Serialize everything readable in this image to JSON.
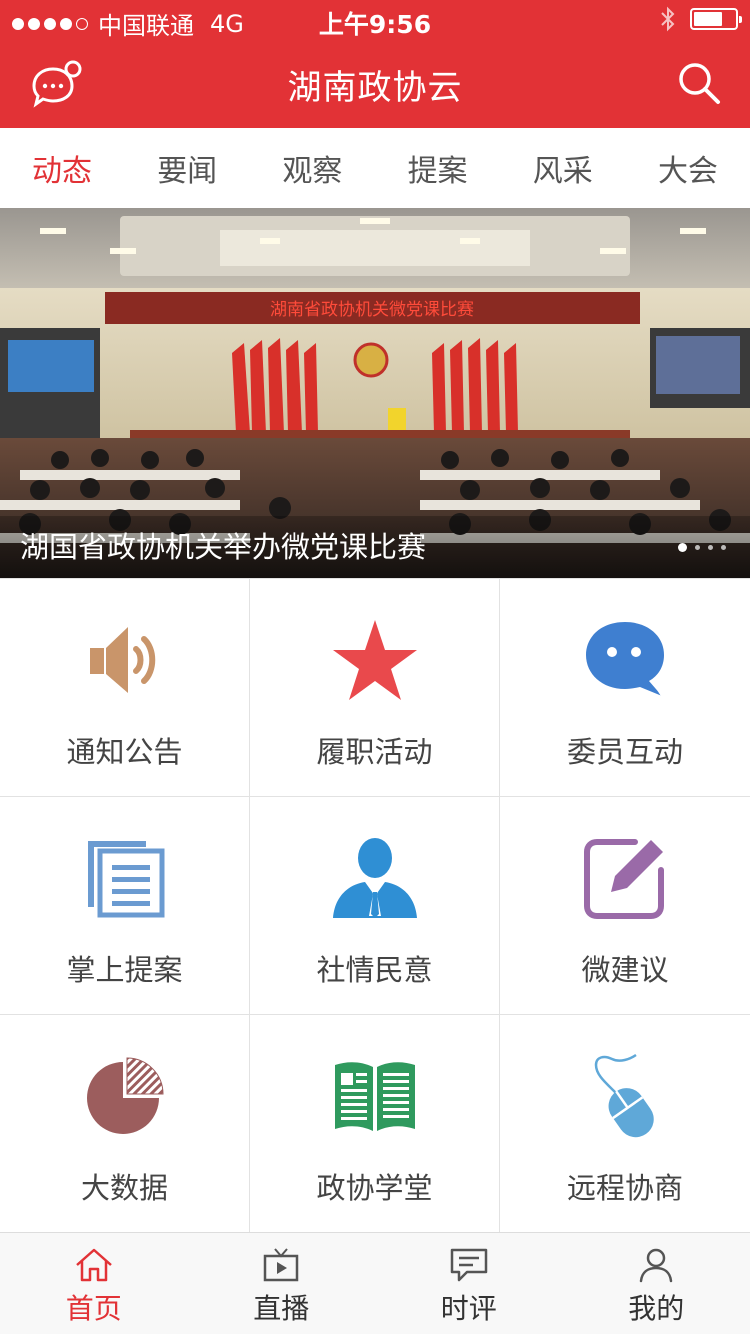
{
  "status_bar": {
    "carrier": "中国联通",
    "network": "4G",
    "time": "上午9:56"
  },
  "header": {
    "title": "湖南政协云",
    "left_icon": "message-bubble-icon",
    "right_icon": "search-icon"
  },
  "tabs": [
    {
      "label": "动态",
      "active": true
    },
    {
      "label": "要闻",
      "active": false
    },
    {
      "label": "观察",
      "active": false
    },
    {
      "label": "提案",
      "active": false
    },
    {
      "label": "风采",
      "active": false
    },
    {
      "label": "大会",
      "active": false
    }
  ],
  "banner": {
    "hall_sign": "湖南省政协机关微党课比赛",
    "caption": "湖国省政协机关举办微党课比赛",
    "page_count": 4,
    "current_page": 1
  },
  "grid": [
    {
      "label": "通知公告",
      "icon": "speaker-icon",
      "color": "#c9956a"
    },
    {
      "label": "履职活动",
      "icon": "star-icon",
      "color": "#e9494c"
    },
    {
      "label": "委员互动",
      "icon": "chat-bubble-icon",
      "color": "#3f7fd0"
    },
    {
      "label": "掌上提案",
      "icon": "documents-icon",
      "color": "#6b9bd1"
    },
    {
      "label": "社情民意",
      "icon": "person-icon",
      "color": "#2f8fd4"
    },
    {
      "label": "微建议",
      "icon": "edit-icon",
      "color": "#9a6aa8"
    },
    {
      "label": "大数据",
      "icon": "pie-chart-icon",
      "color": "#9c5d5d"
    },
    {
      "label": "政协学堂",
      "icon": "book-icon",
      "color": "#2f9a5e"
    },
    {
      "label": "远程协商",
      "icon": "mouse-icon",
      "color": "#5fa8d8"
    }
  ],
  "bottom_nav": [
    {
      "label": "首页",
      "icon": "home-icon",
      "active": true
    },
    {
      "label": "直播",
      "icon": "tv-icon",
      "active": false
    },
    {
      "label": "时评",
      "icon": "comment-icon",
      "active": false
    },
    {
      "label": "我的",
      "icon": "user-icon",
      "active": false
    }
  ],
  "colors": {
    "brand_red": "#e23236"
  }
}
